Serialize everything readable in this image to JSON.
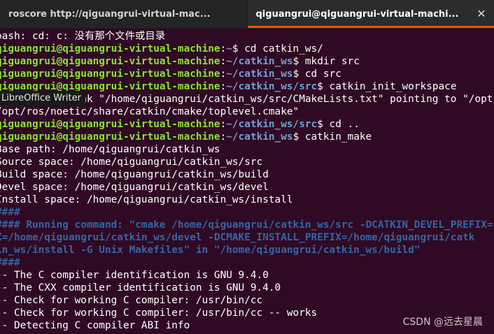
{
  "tabs": [
    {
      "title": "roscore http://qiguangrui-virtual-mac...",
      "active": false
    },
    {
      "title": "qiguangrui@qiguangrui-virtual-machi...",
      "active": true
    }
  ],
  "close_icon": "close-icon",
  "tooltip": "LibreOffice Writer",
  "watermark": "CSDN @远去星晨",
  "colors": {
    "background": "#300a24",
    "user_host": "#8ae234",
    "path": "#729fcf",
    "accent": "#e95420"
  },
  "lines": [
    {
      "text": "bash: cd: c: 没有那个文件或目录"
    },
    {
      "user": "qiguangrui@qiguangrui-virtual-machine",
      "path": "~",
      "cmd": "cd catkin_ws/"
    },
    {
      "user": "qiguangrui@qiguangrui-virtual-machine",
      "path": "~/catkin_ws",
      "cmd": "mkdir src"
    },
    {
      "user": "qiguangrui@qiguangrui-virtual-machine",
      "path": "~/catkin_ws",
      "cmd": "cd src"
    },
    {
      "user": "qiguangrui@qiguangrui-virtual-machine",
      "path": "~/catkin_ws/src",
      "cmd": "catkin_init_workspace"
    },
    {
      "text": "Creating symlink \"/home/qiguangrui/catkin_ws/src/CMakeLists.txt\" pointing to \"/opt/ros/noetic/share/catkin/cmake/toplevel.cmake\""
    },
    {
      "text": "/opt/ros/noetic/share/catkin/cmake/toplevel.cmake\""
    },
    {
      "user": "qiguangrui@qiguangrui-virtual-machine",
      "path": "~/catkin_ws/src",
      "cmd": "cd .."
    },
    {
      "user": "qiguangrui@qiguangrui-virtual-machine",
      "path": "~/catkin_ws",
      "cmd": "catkin_make"
    },
    {
      "text": "Base path: /home/qiguangrui/catkin_ws"
    },
    {
      "text": "Source space: /home/qiguangrui/catkin_ws/src"
    },
    {
      "text": "Build space: /home/qiguangrui/catkin_ws/build"
    },
    {
      "text": "Devel space: /home/qiguangrui/catkin_ws/devel"
    },
    {
      "text": "Install space: /home/qiguangrui/catkin_ws/install"
    },
    {
      "blue": "####"
    },
    {
      "blue": "#### Running command: ",
      "bold": "\"cmake /home/qiguangrui/catkin_ws/src -DCATKIN_DEVEL_PREFIX=/home/qiguangrui/catkin_ws/devel -DCMAKE_INSTALL_PREFIX=/home/qiguangrui/catkin_ws/install -G Unix Makefiles\""
    },
    {
      "bold": "X=/home/qiguangrui/catkin_ws/devel -DCMAKE_INSTALL_PREFIX=/home/qiguangrui/catk"
    },
    {
      "bold": "in_ws/install -G Unix Makefiles\"",
      "blue": " in ",
      "bold2": "\"/home/qiguangrui/catkin_ws/build\""
    },
    {
      "blue": "####"
    },
    {
      "text": "-- The C compiler identification is GNU 9.4.0"
    },
    {
      "text": "-- The CXX compiler identification is GNU 9.4.0"
    },
    {
      "text": "-- Check for working C compiler: /usr/bin/cc"
    },
    {
      "text": "-- Check for working C compiler: /usr/bin/cc -- works"
    },
    {
      "text": "-- Detecting C compiler ABI info"
    }
  ]
}
